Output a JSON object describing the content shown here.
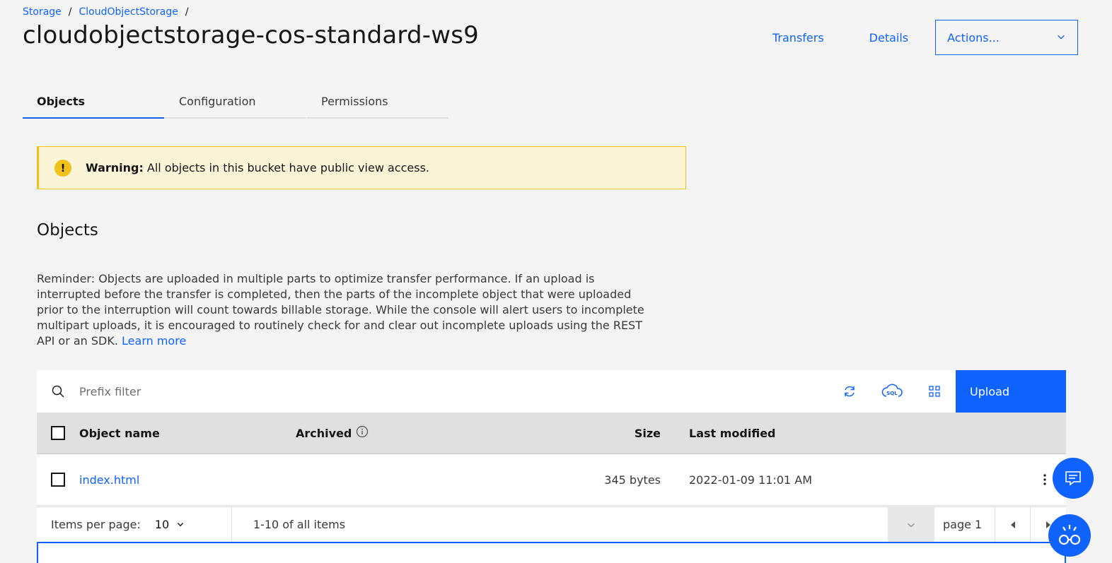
{
  "breadcrumb": {
    "items": [
      "Storage",
      "CloudObjectStorage"
    ],
    "separator": "/"
  },
  "page": {
    "title": "cloudobjectstorage-cos-standard-ws9"
  },
  "header": {
    "transfers_label": "Transfers",
    "details_label": "Details",
    "actions_label": "Actions..."
  },
  "tabs": [
    {
      "label": "Objects",
      "active": true
    },
    {
      "label": "Configuration",
      "active": false
    },
    {
      "label": "Permissions",
      "active": false
    }
  ],
  "warning": {
    "title": "Warning:",
    "message": "All objects in this bucket have public view access."
  },
  "objects": {
    "section_title": "Objects",
    "reminder": "Reminder: Objects are uploaded in multiple parts to optimize transfer performance. If an upload is interrupted before the transfer is completed, then the parts of the incomplete object that were uploaded prior to the interruption will count towards billable storage. While the console will alert users to incomplete multipart uploads, it is encouraged to routinely check for and clear out incomplete uploads using the REST API or an SDK.",
    "learn_more": "Learn more"
  },
  "toolbar": {
    "search_placeholder": "Prefix filter",
    "upload_label": "Upload"
  },
  "table": {
    "headers": {
      "name": "Object name",
      "archived": "Archived",
      "size": "Size",
      "modified": "Last modified"
    },
    "rows": [
      {
        "name": "index.html",
        "archived": "",
        "size": "345 bytes",
        "modified": "2022-01-09 11:01 AM"
      }
    ]
  },
  "pagination": {
    "items_per_page_label": "Items per page:",
    "items_per_page_value": "10",
    "range_text": "1-10 of all items",
    "page_label": "page 1"
  },
  "colors": {
    "accent": "#0f62fe",
    "warning_bg": "#fcf4d6",
    "warning_border": "#f1c21b"
  }
}
